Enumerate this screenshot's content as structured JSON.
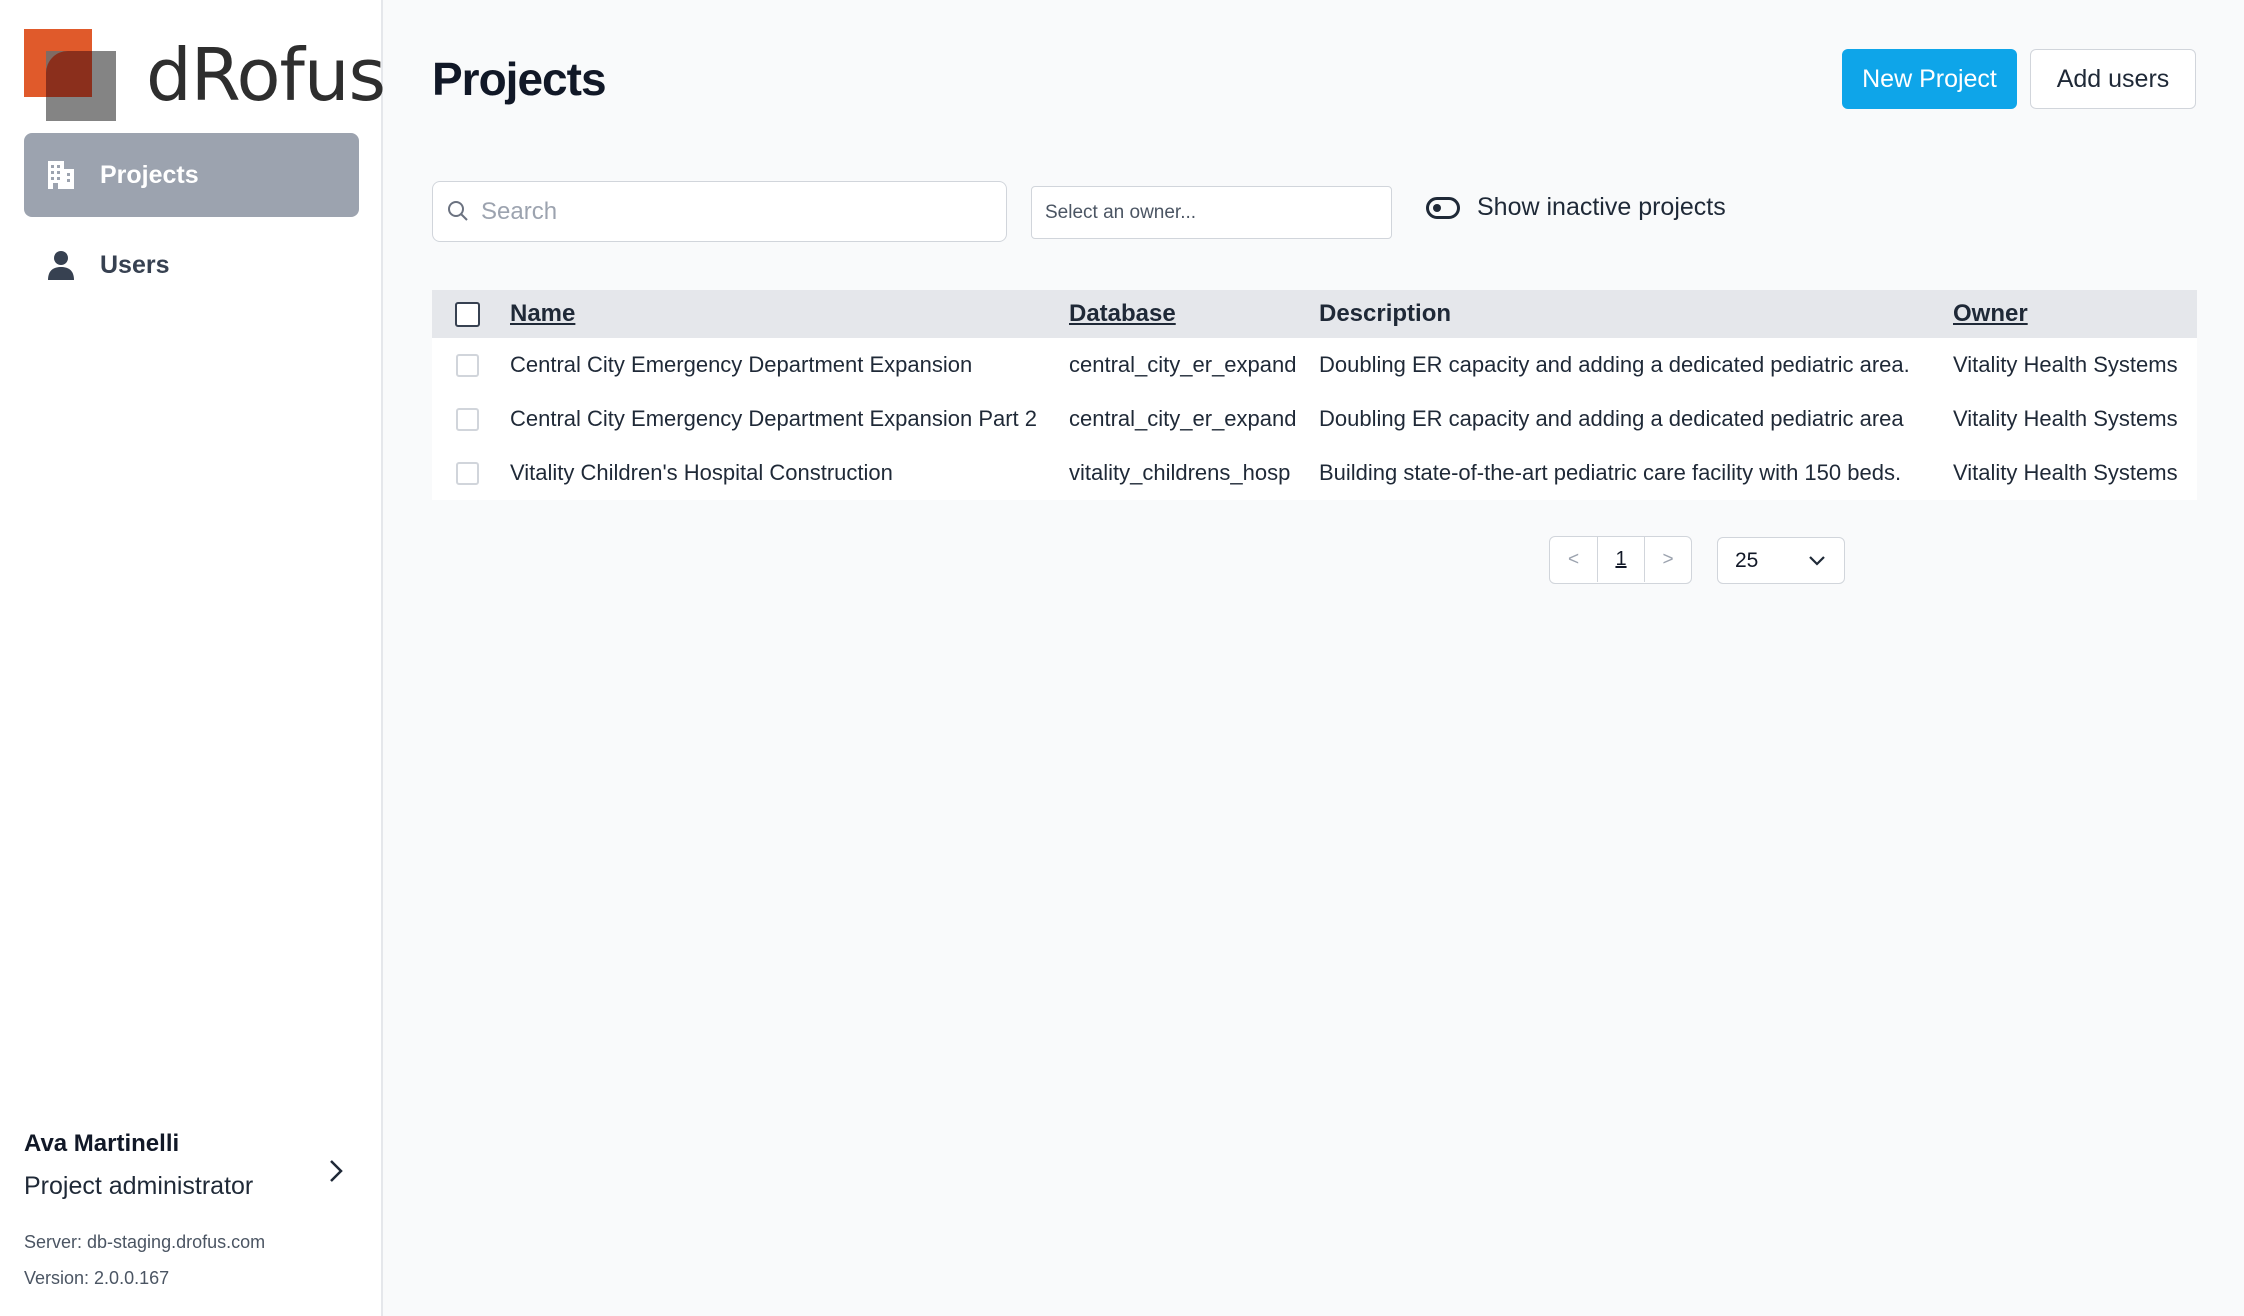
{
  "brand": {
    "name": "dRofus"
  },
  "sidebar": {
    "items": [
      {
        "label": "Projects",
        "icon": "building-icon",
        "active": true
      },
      {
        "label": "Users",
        "icon": "user-icon",
        "active": false
      }
    ],
    "user": {
      "name": "Ava Martinelli",
      "role": "Project administrator",
      "server": "Server: db-staging.drofus.com",
      "version": "Version: 2.0.0.167"
    }
  },
  "header": {
    "title": "Projects",
    "new_project_label": "New Project",
    "add_users_label": "Add users"
  },
  "filters": {
    "search_placeholder": "Search",
    "owner_placeholder": "Select an owner...",
    "show_inactive_label": "Show inactive projects"
  },
  "table": {
    "columns": [
      "Name",
      "Database",
      "Description",
      "Owner"
    ],
    "rows": [
      {
        "name": "Central City Emergency Department Expansion",
        "database": "central_city_er_expand",
        "description": "Doubling ER capacity and adding a dedicated pediatric area.",
        "owner": "Vitality Health Systems"
      },
      {
        "name": "Central City Emergency Department Expansion Part 2",
        "database": "central_city_er_expand",
        "description": "Doubling ER capacity and adding a dedicated pediatric area",
        "owner": "Vitality Health Systems"
      },
      {
        "name": "Vitality Children's Hospital Construction",
        "database": "vitality_childrens_hosp",
        "description": "Building state-of-the-art pediatric care facility with 150 beds.",
        "owner": "Vitality Health Systems"
      }
    ]
  },
  "pagination": {
    "prev": "<",
    "current": "1",
    "next": ">",
    "page_size": "25"
  },
  "colors": {
    "primary": "#0ea5e9",
    "active_nav": "#9ca3af",
    "logo_orange": "#e05a2b"
  }
}
